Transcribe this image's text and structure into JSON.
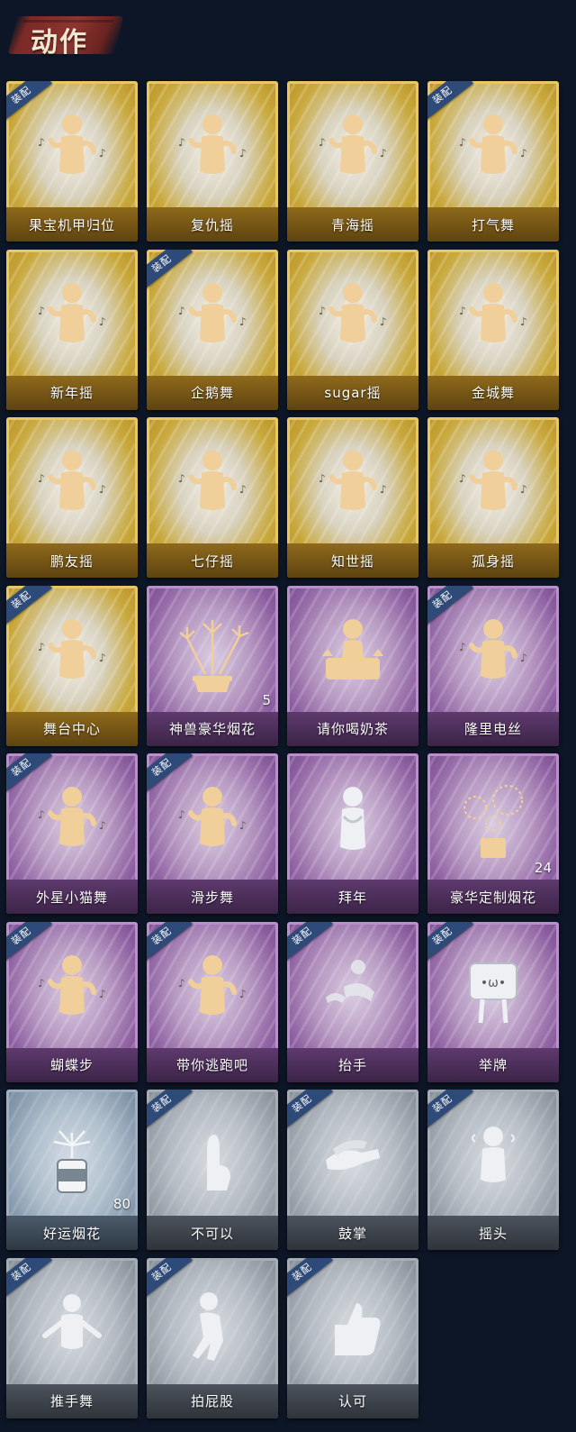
{
  "header": {
    "title": "动作"
  },
  "equip_label": "装配",
  "items": [
    {
      "label": "果宝机甲归位",
      "rarity": "gold",
      "equipped": true,
      "count": "",
      "icon": "dance-figure-icon"
    },
    {
      "label": "复仇摇",
      "rarity": "gold",
      "equipped": false,
      "count": "",
      "icon": "dance-figure-icon"
    },
    {
      "label": "青海摇",
      "rarity": "gold",
      "equipped": false,
      "count": "",
      "icon": "dance-figure-icon"
    },
    {
      "label": "打气舞",
      "rarity": "gold",
      "equipped": true,
      "count": "",
      "icon": "dance-figure-icon"
    },
    {
      "label": "新年摇",
      "rarity": "gold",
      "equipped": false,
      "count": "",
      "icon": "dance-figure-icon"
    },
    {
      "label": "企鹅舞",
      "rarity": "gold",
      "equipped": true,
      "count": "",
      "icon": "dance-figure-icon"
    },
    {
      "label": "sugar摇",
      "rarity": "gold",
      "equipped": false,
      "count": "",
      "icon": "dance-figure-icon"
    },
    {
      "label": "金城舞",
      "rarity": "gold",
      "equipped": false,
      "count": "",
      "icon": "dance-figure-icon"
    },
    {
      "label": "鹏友摇",
      "rarity": "gold",
      "equipped": false,
      "count": "",
      "icon": "dance-figure-icon"
    },
    {
      "label": "七仔摇",
      "rarity": "gold",
      "equipped": false,
      "count": "",
      "icon": "dance-figure-icon"
    },
    {
      "label": "知世摇",
      "rarity": "gold",
      "equipped": false,
      "count": "",
      "icon": "dance-figure-icon"
    },
    {
      "label": "孤身摇",
      "rarity": "gold",
      "equipped": false,
      "count": "",
      "icon": "dance-figure-icon"
    },
    {
      "label": "舞台中心",
      "rarity": "gold",
      "equipped": true,
      "count": "",
      "icon": "dance-figure-icon"
    },
    {
      "label": "神兽豪华烟花",
      "rarity": "purple",
      "equipped": false,
      "count": "5",
      "icon": "fireworks-pot-icon"
    },
    {
      "label": "请你喝奶茶",
      "rarity": "purple",
      "equipped": false,
      "count": "",
      "icon": "milk-tea-icon"
    },
    {
      "label": "隆里电丝",
      "rarity": "purple",
      "equipped": true,
      "count": "",
      "icon": "dance-figure-icon"
    },
    {
      "label": "外星小猫舞",
      "rarity": "purple",
      "equipped": true,
      "count": "",
      "icon": "dance-figure-icon"
    },
    {
      "label": "滑步舞",
      "rarity": "purple",
      "equipped": true,
      "count": "",
      "icon": "dance-figure-icon"
    },
    {
      "label": "拜年",
      "rarity": "purple",
      "equipped": false,
      "count": "",
      "icon": "bow-figure-icon"
    },
    {
      "label": "豪华定制烟花",
      "rarity": "purple",
      "equipped": false,
      "count": "24",
      "icon": "fireworks-box-icon"
    },
    {
      "label": "蝴蝶步",
      "rarity": "purple",
      "equipped": true,
      "count": "",
      "icon": "dance-figure-icon"
    },
    {
      "label": "带你逃跑吧",
      "rarity": "purple",
      "equipped": true,
      "count": "",
      "icon": "dance-figure-icon"
    },
    {
      "label": "抬手",
      "rarity": "purple",
      "equipped": true,
      "count": "",
      "icon": "raise-hand-icon"
    },
    {
      "label": "举牌",
      "rarity": "purple",
      "equipped": true,
      "count": "",
      "icon": "sign-board-icon"
    },
    {
      "label": "好运烟花",
      "rarity": "bluegray",
      "equipped": false,
      "count": "80",
      "icon": "firework-can-icon"
    },
    {
      "label": "不可以",
      "rarity": "gray",
      "equipped": true,
      "count": "",
      "icon": "finger-wag-icon"
    },
    {
      "label": "鼓掌",
      "rarity": "gray",
      "equipped": true,
      "count": "",
      "icon": "clap-icon"
    },
    {
      "label": "摇头",
      "rarity": "gray",
      "equipped": true,
      "count": "",
      "icon": "head-shake-icon"
    },
    {
      "label": "推手舞",
      "rarity": "gray",
      "equipped": true,
      "count": "",
      "icon": "push-dance-icon"
    },
    {
      "label": "拍屁股",
      "rarity": "gray",
      "equipped": true,
      "count": "",
      "icon": "butt-slap-icon"
    },
    {
      "label": "认可",
      "rarity": "gray",
      "equipped": true,
      "count": "",
      "icon": "thumbs-up-icon"
    }
  ]
}
